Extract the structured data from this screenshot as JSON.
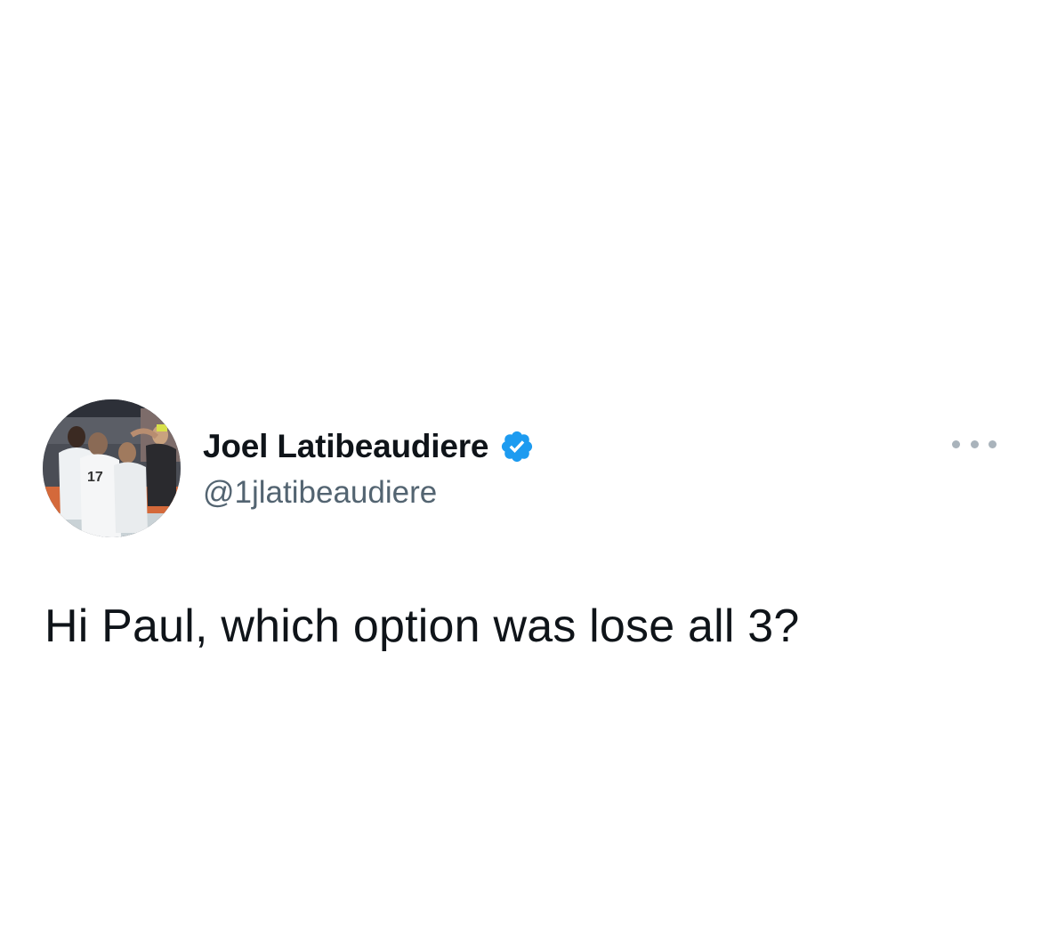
{
  "tweet": {
    "author": {
      "display_name": "Joel Latibeaudiere",
      "handle": "@1jlatibeaudiere",
      "verified": true,
      "verified_icon": "verified-badge-icon",
      "verified_color": "#1d9bf0",
      "avatar_icon": "profile-photo"
    },
    "more_icon": "more-options-icon",
    "text": "Hi Paul, which option was lose all 3?"
  },
  "colors": {
    "text_primary": "#0f1419",
    "text_secondary": "#536471",
    "background": "#ffffff"
  }
}
